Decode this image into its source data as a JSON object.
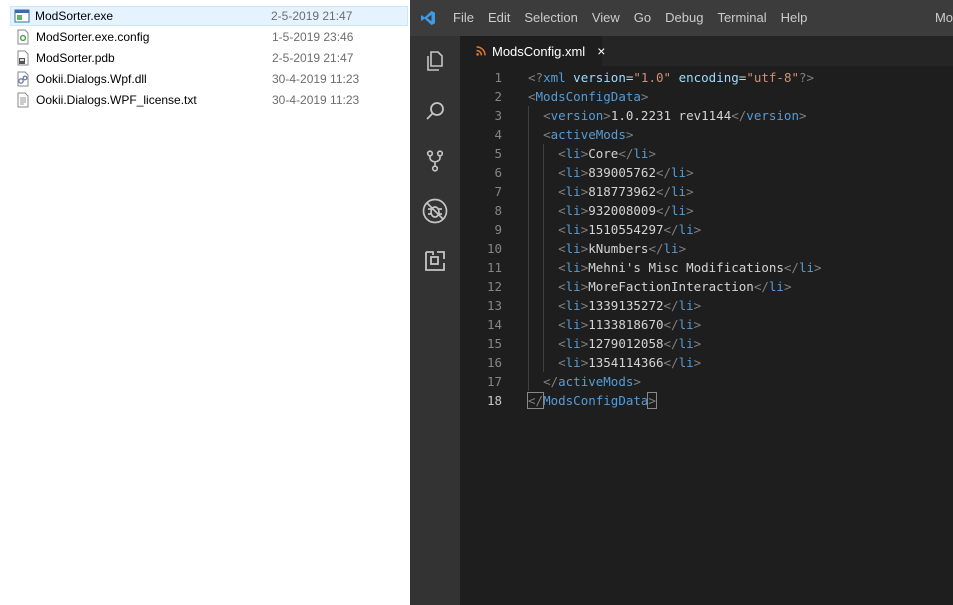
{
  "explorer": {
    "files": [
      {
        "name": "ModSorter.exe",
        "date": "2-5-2019 21:47",
        "icon": "exe-icon",
        "selected": true
      },
      {
        "name": "ModSorter.exe.config",
        "date": "1-5-2019 23:46",
        "icon": "config-file-icon",
        "selected": false
      },
      {
        "name": "ModSorter.pdb",
        "date": "2-5-2019 21:47",
        "icon": "pdb-file-icon",
        "selected": false
      },
      {
        "name": "Ookii.Dialogs.Wpf.dll",
        "date": "30-4-2019 11:23",
        "icon": "dll-file-icon",
        "selected": false
      },
      {
        "name": "Ookii.Dialogs.WPF_license.txt",
        "date": "30-4-2019 11:23",
        "icon": "text-file-icon",
        "selected": false
      }
    ]
  },
  "vscode": {
    "menu": [
      "File",
      "Edit",
      "Selection",
      "View",
      "Go",
      "Debug",
      "Terminal",
      "Help"
    ],
    "title_fragment": "Mo",
    "activity_icons": [
      "explorer-icon",
      "search-icon",
      "source-control-icon",
      "debug-icon",
      "extensions-icon"
    ],
    "tab": {
      "label": "ModsConfig.xml",
      "close": "×",
      "icon": "rss-icon"
    },
    "active_line": 18,
    "lines": [
      {
        "n": 1,
        "indent": 0,
        "tokens": [
          [
            "punc",
            "<?"
          ],
          [
            "tag",
            "xml"
          ],
          [
            "text",
            " "
          ],
          [
            "attr",
            "version"
          ],
          [
            "text",
            "="
          ],
          [
            "str",
            "\"1.0\""
          ],
          [
            "text",
            " "
          ],
          [
            "attr",
            "encoding"
          ],
          [
            "text",
            "="
          ],
          [
            "str",
            "\"utf-8\""
          ],
          [
            "punc",
            "?>"
          ]
        ]
      },
      {
        "n": 2,
        "indent": 0,
        "tokens": [
          [
            "punc",
            "<"
          ],
          [
            "tag",
            "ModsConfigData"
          ],
          [
            "punc",
            ">"
          ]
        ]
      },
      {
        "n": 3,
        "indent": 1,
        "tokens": [
          [
            "punc",
            "<"
          ],
          [
            "tag",
            "version"
          ],
          [
            "punc",
            ">"
          ],
          [
            "text",
            "1.0.2231 rev1144"
          ],
          [
            "punc",
            "</"
          ],
          [
            "tag",
            "version"
          ],
          [
            "punc",
            ">"
          ]
        ]
      },
      {
        "n": 4,
        "indent": 1,
        "tokens": [
          [
            "punc",
            "<"
          ],
          [
            "tag",
            "activeMods"
          ],
          [
            "punc",
            ">"
          ]
        ]
      },
      {
        "n": 5,
        "indent": 2,
        "tokens": [
          [
            "punc",
            "<"
          ],
          [
            "tag",
            "li"
          ],
          [
            "punc",
            ">"
          ],
          [
            "text",
            "Core"
          ],
          [
            "punc",
            "</"
          ],
          [
            "tag",
            "li"
          ],
          [
            "punc",
            ">"
          ]
        ]
      },
      {
        "n": 6,
        "indent": 2,
        "tokens": [
          [
            "punc",
            "<"
          ],
          [
            "tag",
            "li"
          ],
          [
            "punc",
            ">"
          ],
          [
            "text",
            "839005762"
          ],
          [
            "punc",
            "</"
          ],
          [
            "tag",
            "li"
          ],
          [
            "punc",
            ">"
          ]
        ]
      },
      {
        "n": 7,
        "indent": 2,
        "tokens": [
          [
            "punc",
            "<"
          ],
          [
            "tag",
            "li"
          ],
          [
            "punc",
            ">"
          ],
          [
            "text",
            "818773962"
          ],
          [
            "punc",
            "</"
          ],
          [
            "tag",
            "li"
          ],
          [
            "punc",
            ">"
          ]
        ]
      },
      {
        "n": 8,
        "indent": 2,
        "tokens": [
          [
            "punc",
            "<"
          ],
          [
            "tag",
            "li"
          ],
          [
            "punc",
            ">"
          ],
          [
            "text",
            "932008009"
          ],
          [
            "punc",
            "</"
          ],
          [
            "tag",
            "li"
          ],
          [
            "punc",
            ">"
          ]
        ]
      },
      {
        "n": 9,
        "indent": 2,
        "tokens": [
          [
            "punc",
            "<"
          ],
          [
            "tag",
            "li"
          ],
          [
            "punc",
            ">"
          ],
          [
            "text",
            "1510554297"
          ],
          [
            "punc",
            "</"
          ],
          [
            "tag",
            "li"
          ],
          [
            "punc",
            ">"
          ]
        ]
      },
      {
        "n": 10,
        "indent": 2,
        "tokens": [
          [
            "punc",
            "<"
          ],
          [
            "tag",
            "li"
          ],
          [
            "punc",
            ">"
          ],
          [
            "text",
            "kNumbers"
          ],
          [
            "punc",
            "</"
          ],
          [
            "tag",
            "li"
          ],
          [
            "punc",
            ">"
          ]
        ]
      },
      {
        "n": 11,
        "indent": 2,
        "tokens": [
          [
            "punc",
            "<"
          ],
          [
            "tag",
            "li"
          ],
          [
            "punc",
            ">"
          ],
          [
            "text",
            "Mehni's Misc Modifications"
          ],
          [
            "punc",
            "</"
          ],
          [
            "tag",
            "li"
          ],
          [
            "punc",
            ">"
          ]
        ]
      },
      {
        "n": 12,
        "indent": 2,
        "tokens": [
          [
            "punc",
            "<"
          ],
          [
            "tag",
            "li"
          ],
          [
            "punc",
            ">"
          ],
          [
            "text",
            "MoreFactionInteraction"
          ],
          [
            "punc",
            "</"
          ],
          [
            "tag",
            "li"
          ],
          [
            "punc",
            ">"
          ]
        ]
      },
      {
        "n": 13,
        "indent": 2,
        "tokens": [
          [
            "punc",
            "<"
          ],
          [
            "tag",
            "li"
          ],
          [
            "punc",
            ">"
          ],
          [
            "text",
            "1339135272"
          ],
          [
            "punc",
            "</"
          ],
          [
            "tag",
            "li"
          ],
          [
            "punc",
            ">"
          ]
        ]
      },
      {
        "n": 14,
        "indent": 2,
        "tokens": [
          [
            "punc",
            "<"
          ],
          [
            "tag",
            "li"
          ],
          [
            "punc",
            ">"
          ],
          [
            "text",
            "1133818670"
          ],
          [
            "punc",
            "</"
          ],
          [
            "tag",
            "li"
          ],
          [
            "punc",
            ">"
          ]
        ]
      },
      {
        "n": 15,
        "indent": 2,
        "tokens": [
          [
            "punc",
            "<"
          ],
          [
            "tag",
            "li"
          ],
          [
            "punc",
            ">"
          ],
          [
            "text",
            "1279012058"
          ],
          [
            "punc",
            "</"
          ],
          [
            "tag",
            "li"
          ],
          [
            "punc",
            ">"
          ]
        ]
      },
      {
        "n": 16,
        "indent": 2,
        "tokens": [
          [
            "punc",
            "<"
          ],
          [
            "tag",
            "li"
          ],
          [
            "punc",
            ">"
          ],
          [
            "text",
            "1354114366"
          ],
          [
            "punc",
            "</"
          ],
          [
            "tag",
            "li"
          ],
          [
            "punc",
            ">"
          ]
        ]
      },
      {
        "n": 17,
        "indent": 1,
        "tokens": [
          [
            "punc",
            "</"
          ],
          [
            "tag",
            "activeMods"
          ],
          [
            "punc",
            ">"
          ]
        ]
      },
      {
        "n": 18,
        "indent": 0,
        "tokens": [
          [
            "punc",
            "</"
          ],
          [
            "tag",
            "ModsConfigData"
          ],
          [
            "punc",
            ">"
          ]
        ]
      }
    ]
  }
}
